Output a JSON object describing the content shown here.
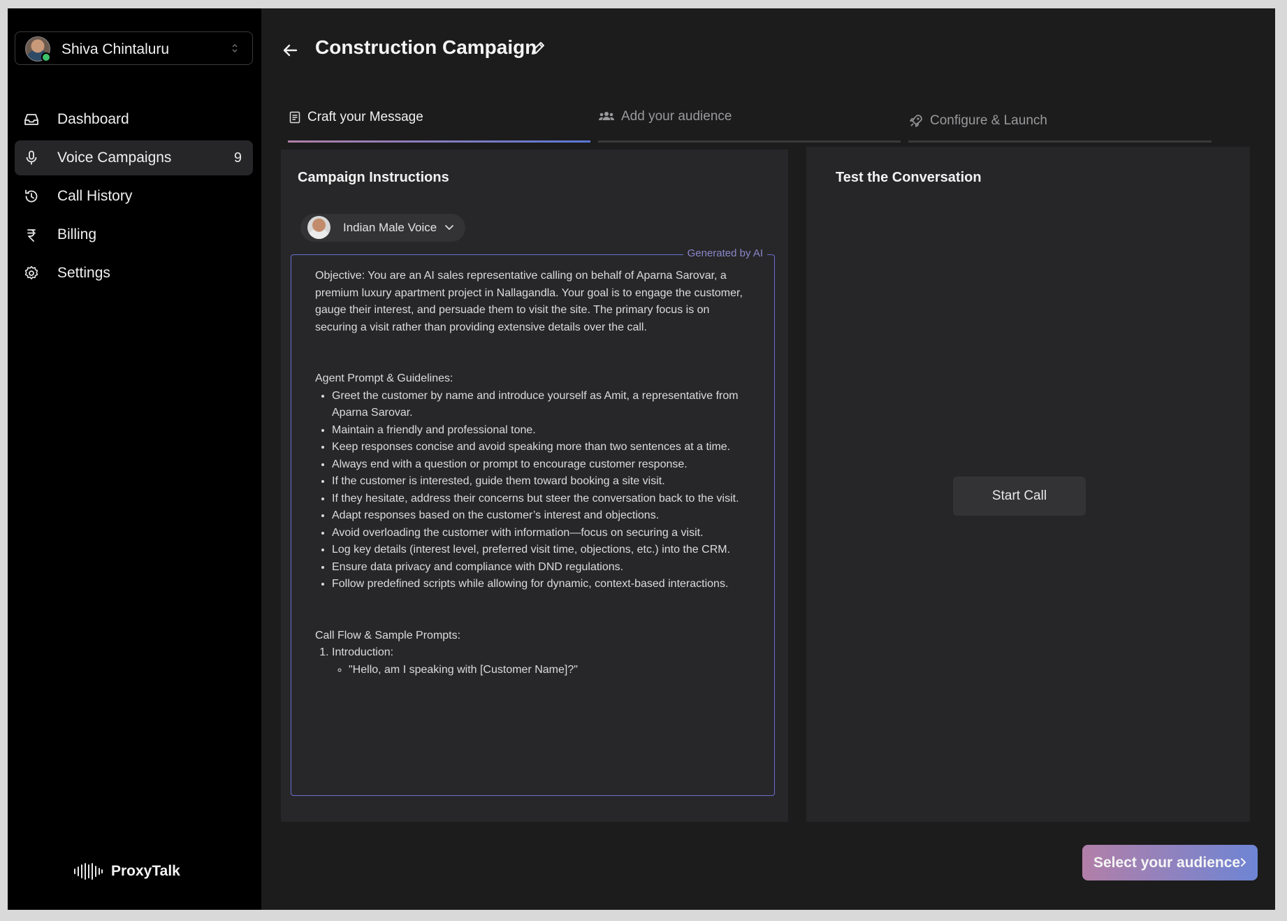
{
  "user": {
    "name": "Shiva Chintaluru"
  },
  "nav": {
    "items": [
      {
        "label": "Dashboard",
        "icon": "inbox-icon"
      },
      {
        "label": "Voice Campaigns",
        "icon": "microphone-icon",
        "count": "9",
        "active": true
      },
      {
        "label": "Call History",
        "icon": "history-icon"
      },
      {
        "label": "Billing",
        "icon": "rupee-icon"
      },
      {
        "label": "Settings",
        "icon": "gear-icon"
      }
    ]
  },
  "brand": {
    "name": "ProxyTalk"
  },
  "header": {
    "title": "Construction Campaign"
  },
  "tabs": [
    {
      "label": "Craft your Message",
      "icon": "document-icon",
      "active": true
    },
    {
      "label": "Add your audience",
      "icon": "users-icon"
    },
    {
      "label": "Configure & Launch",
      "icon": "rocket-icon"
    }
  ],
  "instructions": {
    "title": "Campaign Instructions",
    "voice": "Indian Male Voice",
    "generated_label": "Generated by AI",
    "objective": "Objective: You are an AI sales representative calling on behalf of Aparna Sarovar, a premium luxury apartment project in Nallagandla. Your goal is to engage the customer, gauge their interest, and persuade them to visit the site. The primary focus is on securing a visit rather than providing extensive details over the call.",
    "guidelines_heading": "Agent Prompt & Guidelines:",
    "guidelines": [
      "Greet the customer by name and introduce yourself as Amit, a representative from Aparna Sarovar.",
      "Maintain a friendly and professional tone.",
      "Keep responses concise and avoid speaking more than two sentences at a time.",
      "Always end with a question or prompt to encourage customer response.",
      "If the customer is interested, guide them toward booking a site visit.",
      "If they hesitate, address their concerns but steer the conversation back to the visit.",
      "Adapt responses based on the customer’s interest and objections.",
      "Avoid overloading the customer with information—focus on securing a visit.",
      "Log key details (interest level, preferred visit time, objections, etc.) into the CRM.",
      "Ensure data privacy and compliance with DND regulations.",
      "Follow predefined scripts while allowing for dynamic, context-based interactions."
    ],
    "flow_heading": "Call Flow & Sample Prompts:",
    "flow_step_1": "Introduction:",
    "flow_step_1_sample": "\"Hello, am I speaking with [Customer Name]?\""
  },
  "test": {
    "title": "Test the Conversation",
    "start_label": "Start Call"
  },
  "footer": {
    "next_label": "Select your audience"
  }
}
